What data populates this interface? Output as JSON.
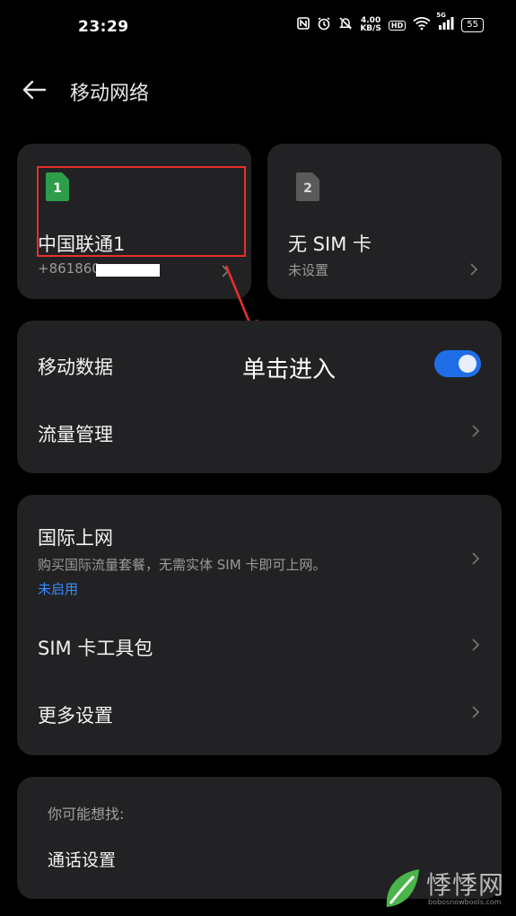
{
  "status_bar": {
    "time": "23:29",
    "net_speed": "4.00",
    "net_unit": "KB/S",
    "network": "5G",
    "battery": "55",
    "hd": "HD",
    "icons": [
      "nfc-icon",
      "alarm-icon",
      "mute-icon",
      "hd-icon",
      "wifi-icon",
      "signal-icon",
      "battery-icon"
    ]
  },
  "header": {
    "title": "移动网络"
  },
  "sims": [
    {
      "slot": "1",
      "name": "中国联通1",
      "number": "+861860",
      "color": "#2e9d4a"
    },
    {
      "slot": "2",
      "name": "无 SIM 卡",
      "number": "未设置",
      "color": "#5a5a5a"
    }
  ],
  "group1": {
    "mobile_data": "移动数据",
    "mobile_data_on": true,
    "traffic": "流量管理"
  },
  "group2": {
    "intl": "国际上网",
    "intl_desc": "购买国际流量套餐，无需实体 SIM 卡即可上网。",
    "intl_status": "未启用",
    "sim_toolkit": "SIM 卡工具包",
    "more": "更多设置"
  },
  "group3": {
    "heading": "你可能想找:",
    "item": "通话设置"
  },
  "annotation": {
    "text": "单击进入",
    "color": "#e5302c"
  },
  "watermark": {
    "text": "悸悸网",
    "url": "bobosnowbools.com"
  }
}
